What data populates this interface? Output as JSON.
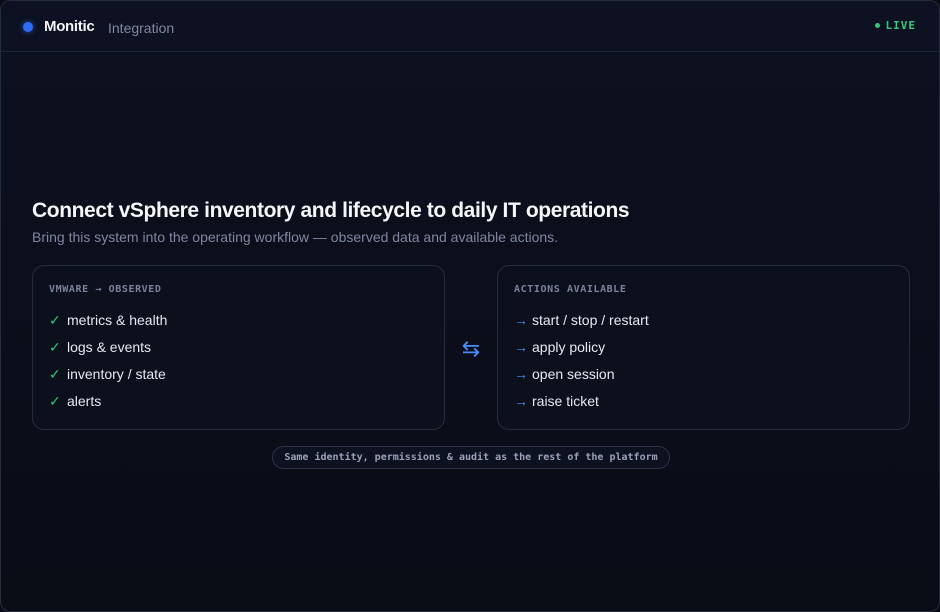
{
  "header": {
    "brand": "Monitic",
    "section": "Integration",
    "status": "LIVE"
  },
  "hero": {
    "title": "Connect vSphere inventory and lifecycle to daily IT operations",
    "subtitle": "Bring this system into the operating workflow — observed data and available actions."
  },
  "observed": {
    "title": "VMWARE → OBSERVED",
    "mark": "✓",
    "items": [
      "metrics & health",
      "logs & events",
      "inventory / state",
      "alerts"
    ]
  },
  "actions": {
    "title": "ACTIONS AVAILABLE",
    "mark": "→",
    "items": [
      "start / stop / restart",
      "apply policy",
      "open session",
      "raise ticket"
    ]
  },
  "connector": {
    "glyph": "⇆"
  },
  "footnote": {
    "text": "Same identity, permissions & audit as the rest of the platform"
  },
  "colors": {
    "accent": "#2f6df6",
    "arrow": "#4a8cf7",
    "live": "#33c97a",
    "background": "#0a0c15"
  },
  "icons": {
    "brand": "brand-dot-icon",
    "live": "status-dot-icon",
    "check": "check-icon",
    "arrow": "arrow-right-icon",
    "swap": "swap-arrows-icon"
  }
}
